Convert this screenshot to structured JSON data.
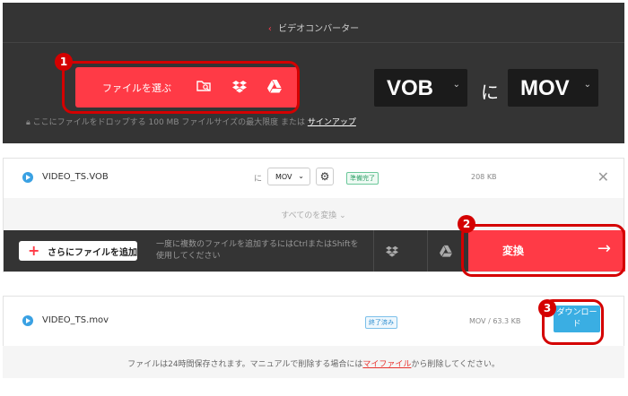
{
  "header": {
    "breadcrumb": "ビデオコンバーター"
  },
  "upload": {
    "choose_label": "ファイルを選ぶ",
    "drop_hint": "ここにファイルをドロップする 100 MB ファイルサイズの最大限度 または",
    "signup_link": "サインアップ",
    "icons": [
      "folder-search-icon",
      "dropbox-icon",
      "google-drive-icon"
    ]
  },
  "format": {
    "from": "VOB",
    "connector": "に",
    "to": "MOV"
  },
  "file1": {
    "name": "VIDEO_TS.VOB",
    "to_label": "に",
    "format_value": "MOV",
    "status": "準備完了",
    "size": "208 KB",
    "convert_all": "すべてのを変換"
  },
  "action_bar": {
    "add_label": "さらにファイルを追加",
    "hint": "一度に複数のファイルを追加するにはCtrlまたはShiftを使用してください",
    "convert_label": "変換"
  },
  "file2": {
    "name": "VIDEO_TS.mov",
    "status": "終了済み",
    "size": "MOV / 63.3 KB",
    "download_label": "ダウンロード"
  },
  "notice": {
    "text_before": "ファイルは24時間保存されます。マニュアルで削除する場合には",
    "link": "マイファイル",
    "text_after": "から削除してください。"
  },
  "annotations": [
    "1",
    "2",
    "3"
  ],
  "colors": {
    "accent": "#ff3a46",
    "annotation": "#d40000",
    "download": "#3aaee3",
    "dark": "#343434"
  }
}
